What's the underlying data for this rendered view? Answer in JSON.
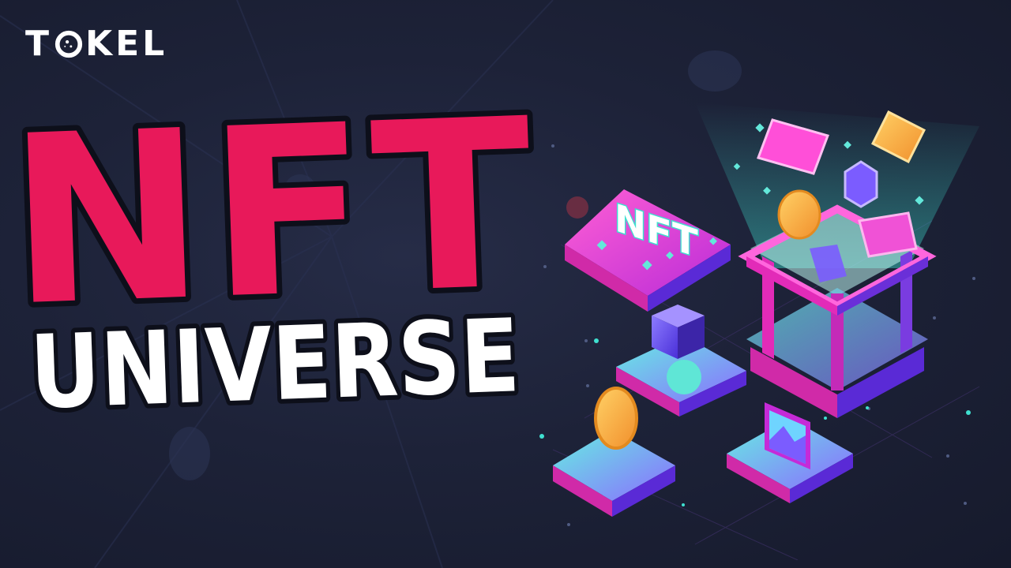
{
  "brand": {
    "logo_left": "T",
    "logo_right": "KEL",
    "logo_icon": "planet-o-icon"
  },
  "headline": {
    "line1": "NFT",
    "line2": "UNIVERSE"
  },
  "illustration": {
    "sign_text": "NFT",
    "icons": [
      "nft-sign-icon",
      "coin-icon",
      "cube-icon",
      "sphere-icon",
      "picture-frame-icon",
      "gem-icon",
      "open-box-icon"
    ]
  },
  "colors": {
    "headline_red": "#e8195a",
    "headline_white": "#ffffff",
    "outline": "#0d0f1a",
    "magenta": "#e22bb8",
    "cyan": "#3fe0d0",
    "violet": "#7b5cff",
    "gold": "#f7b63c"
  }
}
